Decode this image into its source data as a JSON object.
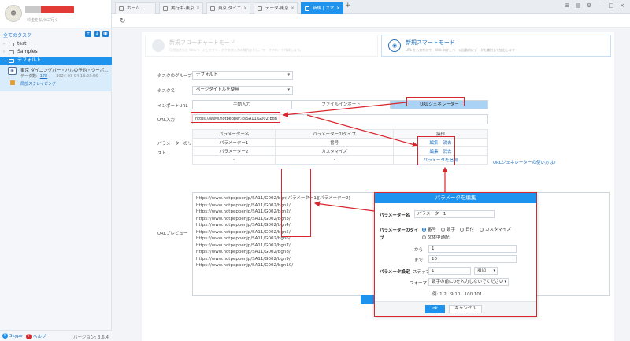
{
  "sidebar": {
    "plan_label": "料金を払うに行く",
    "all_tasks": "全てのタスク",
    "tree": [
      {
        "label": "test"
      },
      {
        "label": "Samples"
      },
      {
        "label": "デフォルト"
      }
    ],
    "task": {
      "title": "東京 ダイニングバー・バルの予約・クーポ...",
      "data_label": "データ数:",
      "count": "178",
      "date": "2024-03-04 13:23:56",
      "link": "局部スクレイピング"
    },
    "footer": {
      "skype": "Skype",
      "help": "ヘルプ",
      "version": "バージョン: 3.6.4"
    }
  },
  "tabs": [
    {
      "label": "ホーム..."
    },
    {
      "label": "実行中-東京..."
    },
    {
      "label": "東京 ダイニ..."
    },
    {
      "label": "データ-東京..."
    },
    {
      "label": "新規 | スマ..."
    }
  ],
  "modes": {
    "flow": {
      "title": "新規フローチャートモード",
      "desc": "可視化された Webページ上でクリックや文字入力の操作を行い、ワークフローを作成します。"
    },
    "smart": {
      "title": "新規スマートモード",
      "desc": "URL を入力だけで、Web 向け上ページ自動的にデータを識別して抽出します"
    }
  },
  "form": {
    "group_label": "タスクのグループ",
    "group_value": "デフォルト",
    "name_label": "タスク名",
    "name_value": "ページタイトルを使用",
    "import_label": "インポートURL",
    "seg_manual": "手動入力",
    "seg_file": "ファイルインポート",
    "seg_generator": "URLジェネレーター",
    "url_label": "URL入力",
    "url_value": "https://www.hotpepper.jp/SA11/G002/bgn",
    "param_list_label_1": "パラメーターのリ",
    "param_list_label_2": "スト",
    "col_name": "パラメーター名",
    "col_type": "パラメーターのタイプ",
    "col_ops": "操作",
    "rows": [
      {
        "name": "パラメーター1",
        "type": "番号",
        "edit": "編集",
        "delete": "消去"
      },
      {
        "name": "パラメーター2",
        "type": "カスタマイズ",
        "edit": "編集",
        "delete": "消去"
      }
    ],
    "empty_row": {
      "name": "-",
      "type": "-"
    },
    "add_param": "パラメータを追加",
    "generator_help": "URLジェネレーターの使い方は?",
    "preview_label": "URLプレビュー",
    "preview_lines": [
      "https://www.hotpepper.jp/SA11/G002/bgn[パラメーター1][パラメーター2]",
      "https://www.hotpepper.jp/SA11/G002/bgn1/",
      "https://www.hotpepper.jp/SA11/G002/bgn2/",
      "https://www.hotpepper.jp/SA11/G002/bgn3/",
      "https://www.hotpepper.jp/SA11/G002/bgn4/",
      "https://www.hotpepper.jp/SA11/G002/bgn5/",
      "https://www.hotpepper.jp/SA11/G002/bgn6/",
      "https://www.hotpepper.jp/SA11/G002/bgn7/",
      "https://www.hotpepper.jp/SA11/G002/bgn8/",
      "https://www.hotpepper.jp/SA11/G002/bgn9/",
      "https://www.hotpepper.jp/SA11/G002/bgn10/"
    ],
    "generate_button": "検"
  },
  "modal": {
    "title": "パラメータを編集",
    "name_label": "パラメーター名",
    "name_value": "パラメーター1",
    "type_label_1": "パラメーターのタイ",
    "type_label_2": "プ",
    "types": [
      "番号",
      "数字",
      "日付",
      "カスタマイズ",
      "文体中通配"
    ],
    "from_label": "から",
    "from_value": "1",
    "to_label": "まで",
    "to_value": "10",
    "settings_label": "パラメータ設定",
    "step_label": "ステップ",
    "step_value": "1",
    "step_dir": "増加",
    "format_label": "フォーマット",
    "format_value": "数字の前に0を入力しないでください",
    "example": "例: 1,2...9,10...100,101",
    "ok": "ok",
    "cancel": "キャンセル"
  },
  "colors": {
    "accent": "#1e93ee",
    "annotation": "#d9262e",
    "link": "#1e6fbf"
  }
}
